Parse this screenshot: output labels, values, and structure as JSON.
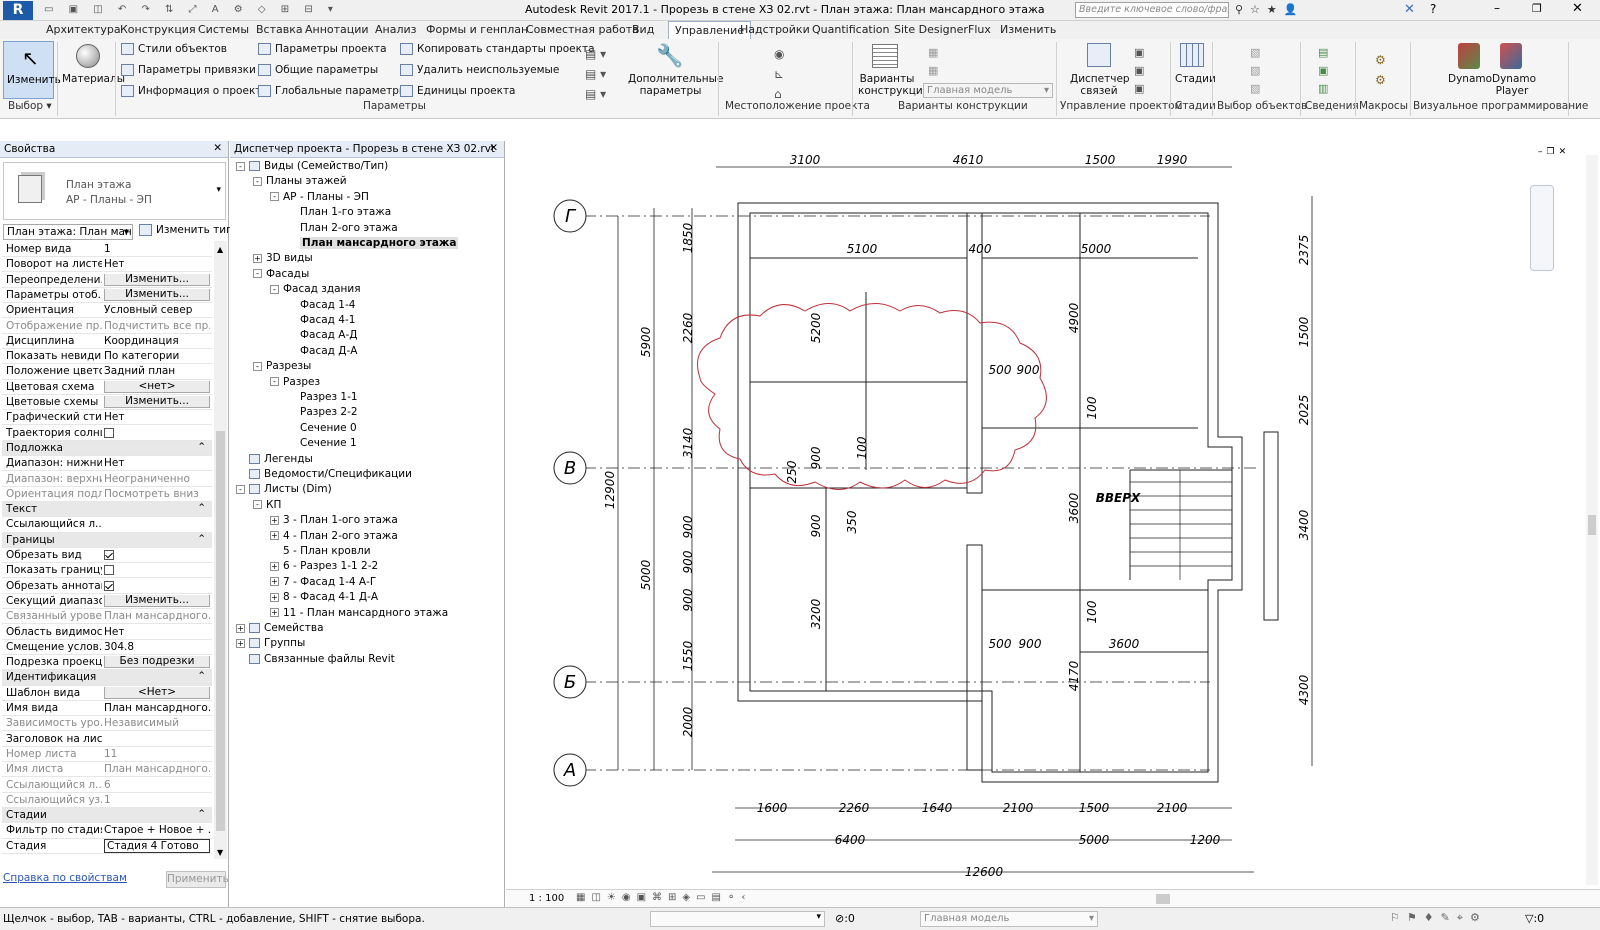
{
  "app": {
    "title": "Autodesk Revit 2017.1 -    Прорезь в стене ХЗ 02.rvt - План этажа: План мансардного этажа",
    "search_placeholder": "Введите ключевое слово/фразу"
  },
  "ribbon": {
    "tabs": [
      "Архитектура",
      "Конструкция",
      "Системы",
      "Вставка",
      "Аннотации",
      "Анализ",
      "Формы и генплан",
      "Совместная работа",
      "Вид",
      "Управление",
      "Надстройки",
      "Quantification",
      "Site Designer",
      "Flux",
      "Изменить"
    ],
    "active_tab": "Управление",
    "select_group": {
      "modify_label": "Изменить",
      "group": "Выбор"
    },
    "materials_label": "Материалы",
    "params_col1": [
      "Стили объектов",
      "Параметры привязки",
      "Информация о проекте"
    ],
    "params_col2": [
      "Параметры проекта",
      "Общие параметры",
      "Глобальные параметры"
    ],
    "params_col3": [
      "Копировать стандарты проекта",
      "Удалить неиспользуемые",
      "Единицы проекта"
    ],
    "params_group": "Параметры",
    "extra_params_label": "Дополнительные параметры",
    "location_group": "Местоположение проекта",
    "design_options_label": "Варианты конструкции",
    "design_options_value": "Главная модель",
    "design_options_group": "Варианты конструкции",
    "link_manager_label": "Диспетчер связей",
    "manage_project_group": "Управление проектом",
    "phases_label": "Стадии",
    "phases_group": "Стадии",
    "select_objects_group": "Выбор объектов",
    "info_group": "Сведения",
    "macros_group": "Макросы",
    "dynamo_label": "Dynamo",
    "dynamo_player_label": "Dynamo Player",
    "visual_programming_group": "Визуальное программирование"
  },
  "properties": {
    "header": "Свойства",
    "type_line1": "План этажа",
    "type_line2": "АР - Планы - ЭП",
    "filter": "План этажа: План мансс",
    "edit_type": "Изменить тип",
    "rows": [
      {
        "k": "Номер вида",
        "v": "1"
      },
      {
        "k": "Поворот на листе",
        "v": "Нет"
      },
      {
        "k": "Переопределени...",
        "v": "Изменить...",
        "btn": true
      },
      {
        "k": "Параметры отоб...",
        "v": "Изменить...",
        "btn": true
      },
      {
        "k": "Ориентация",
        "v": "Условный север"
      },
      {
        "k": "Отображение пр...",
        "v": "Подчистить все пр...",
        "grey": true
      },
      {
        "k": "Дисциплина",
        "v": "Координация"
      },
      {
        "k": "Показать невиди...",
        "v": "По категории"
      },
      {
        "k": "Положение цвето...",
        "v": "Задний план"
      },
      {
        "k": "Цветовая схема",
        "v": "<нет>",
        "btn": true
      },
      {
        "k": "Цветовые схемы ...",
        "v": "Изменить...",
        "btn": true
      },
      {
        "k": "Графический сти...",
        "v": "Нет"
      },
      {
        "k": "Траектория солнца",
        "check": false
      },
      {
        "section": "Подложка"
      },
      {
        "k": "Диапазон: нижни...",
        "v": "Нет"
      },
      {
        "k": "Диапазон: верхни...",
        "v": "Неограниченно",
        "grey": true
      },
      {
        "k": "Ориентация подл...",
        "v": "Посмотреть вниз",
        "grey": true
      },
      {
        "section": "Текст"
      },
      {
        "k": "Ссылающийся л...",
        "v": ""
      },
      {
        "section": "Границы"
      },
      {
        "k": "Обрезать вид",
        "check": true
      },
      {
        "k": "Показать границу...",
        "check": false
      },
      {
        "k": "Обрезать аннотац...",
        "check": true
      },
      {
        "k": "Секущий диапазон",
        "v": "Изменить...",
        "btn": true
      },
      {
        "k": "Связанный уровень",
        "v": "План мансардного...",
        "grey": true
      },
      {
        "k": "Область видимости",
        "v": "Нет"
      },
      {
        "k": "Смещение услов...",
        "v": "304.8"
      },
      {
        "k": "Подрезка проекции",
        "v": "Без подрезки",
        "btn": true
      },
      {
        "section": "Идентификация"
      },
      {
        "k": "Шаблон вида",
        "v": "<Нет>",
        "btn": true
      },
      {
        "k": "Имя вида",
        "v": "План мансардного..."
      },
      {
        "k": "Зависимость уро...",
        "v": "Независимый",
        "grey": true
      },
      {
        "k": "Заголовок на листе",
        "v": ""
      },
      {
        "k": "Номер листа",
        "v": "11",
        "grey": true
      },
      {
        "k": "Имя листа",
        "v": "План мансардного...",
        "grey": true
      },
      {
        "k": "Ссылающийся л...",
        "v": "6",
        "grey": true
      },
      {
        "k": "Ссылающийся уз...",
        "v": "1",
        "grey": true
      },
      {
        "section": "Стадии"
      },
      {
        "k": "Фильтр по стадиям",
        "v": "Старое + Новое + ..."
      },
      {
        "k": "Стадия",
        "v": "Стадия 4 Готово",
        "boxed": true
      }
    ],
    "help_link": "Справка по свойствам",
    "apply": "Применить"
  },
  "browser": {
    "header": "Диспетчер проекта - Прорезь в стене ХЗ 02.rvt",
    "nodes": [
      {
        "t": "Виды (Семейство/Тип)",
        "lvl": 0,
        "tog": "-"
      },
      {
        "t": "Планы этажей",
        "lvl": 1,
        "tog": "-"
      },
      {
        "t": "АР - Планы - ЭП",
        "lvl": 2,
        "tog": "-"
      },
      {
        "t": "План 1-го этажа",
        "lvl": 3
      },
      {
        "t": "План 2-ого этажа",
        "lvl": 3
      },
      {
        "t": "План мансардного этажа",
        "lvl": 3,
        "selected": true
      },
      {
        "t": "3D виды",
        "lvl": 1,
        "tog": "+"
      },
      {
        "t": "Фасады",
        "lvl": 1,
        "tog": "-"
      },
      {
        "t": "Фасад здания",
        "lvl": 2,
        "tog": "-"
      },
      {
        "t": "Фасад 1-4",
        "lvl": 3
      },
      {
        "t": "Фасад 4-1",
        "lvl": 3
      },
      {
        "t": "Фасад А-Д",
        "lvl": 3
      },
      {
        "t": "Фасад Д-А",
        "lvl": 3
      },
      {
        "t": "Разрезы",
        "lvl": 1,
        "tog": "-"
      },
      {
        "t": "Разрез",
        "lvl": 2,
        "tog": "-"
      },
      {
        "t": "Разрез 1-1",
        "lvl": 3
      },
      {
        "t": "Разрез 2-2",
        "lvl": 3
      },
      {
        "t": "Сечение 0",
        "lvl": 3
      },
      {
        "t": "Сечение 1",
        "lvl": 3
      },
      {
        "t": "Легенды",
        "lvl": 0
      },
      {
        "t": "Ведомости/Спецификации",
        "lvl": 0
      },
      {
        "t": "Листы (Dim)",
        "lvl": 0,
        "tog": "-"
      },
      {
        "t": "КП",
        "lvl": 1,
        "tog": "-"
      },
      {
        "t": "3 - План 1-ого этажа",
        "lvl": 2,
        "tog": "+"
      },
      {
        "t": "4 - План 2-ого этажа",
        "lvl": 2,
        "tog": "+"
      },
      {
        "t": "5 - План кровли",
        "lvl": 2
      },
      {
        "t": "6 - Разрез 1-1 2-2",
        "lvl": 2,
        "tog": "+"
      },
      {
        "t": "7 - Фасад 1-4 А-Г",
        "lvl": 2,
        "tog": "+"
      },
      {
        "t": "8 - Фасад 4-1 Д-А",
        "lvl": 2,
        "tog": "+"
      },
      {
        "t": "11 - План мансардного этажа",
        "lvl": 2,
        "tog": "+"
      },
      {
        "t": "Семейства",
        "lvl": 0,
        "tog": "+"
      },
      {
        "t": "Группы",
        "lvl": 0,
        "tog": "+"
      },
      {
        "t": "Связанные файлы Revit",
        "lvl": 0
      }
    ]
  },
  "drawing": {
    "grid": [
      "Г",
      "В",
      "Б",
      "А"
    ],
    "dims_top": [
      "3100",
      "4610",
      "1500",
      "1990"
    ],
    "dims_bottom_1": [
      "1600",
      "2260",
      "1640",
      "2100",
      "1500",
      "2100"
    ],
    "dims_bottom_2": [
      "6400",
      "5000",
      "1200"
    ],
    "dims_bottom_3": "12600",
    "dims_left_1": [
      "1850",
      "2260",
      "3140",
      "900",
      "900",
      "900",
      "1550",
      "2000"
    ],
    "dims_left_2": [
      "5900",
      "5000"
    ],
    "dims_left_3": "12900",
    "dims_right_1": [
      "2375",
      "1500",
      "2025",
      "3400",
      "4300"
    ],
    "dims_inner": [
      "5100",
      "400",
      "5000",
      "5200",
      "4900",
      "500",
      "900",
      "100",
      "900",
      "250",
      "100",
      "900",
      "350",
      "3600",
      "3200",
      "100",
      "500",
      "900",
      "3600",
      "4170"
    ],
    "stair_label": "ВВЕРХ",
    "scale": "1 : 100"
  },
  "status": {
    "hint": "Щелчок - выбор, TAB - варианты, CTRL - добавление, SHIFT - снятие выбора.",
    "zero": ":0",
    "model": "Главная модель",
    "filter_count": ":0"
  },
  "colors": {
    "cloud": "#c0303a",
    "arrow": "#d03030",
    "accent": "#3c6db5"
  }
}
